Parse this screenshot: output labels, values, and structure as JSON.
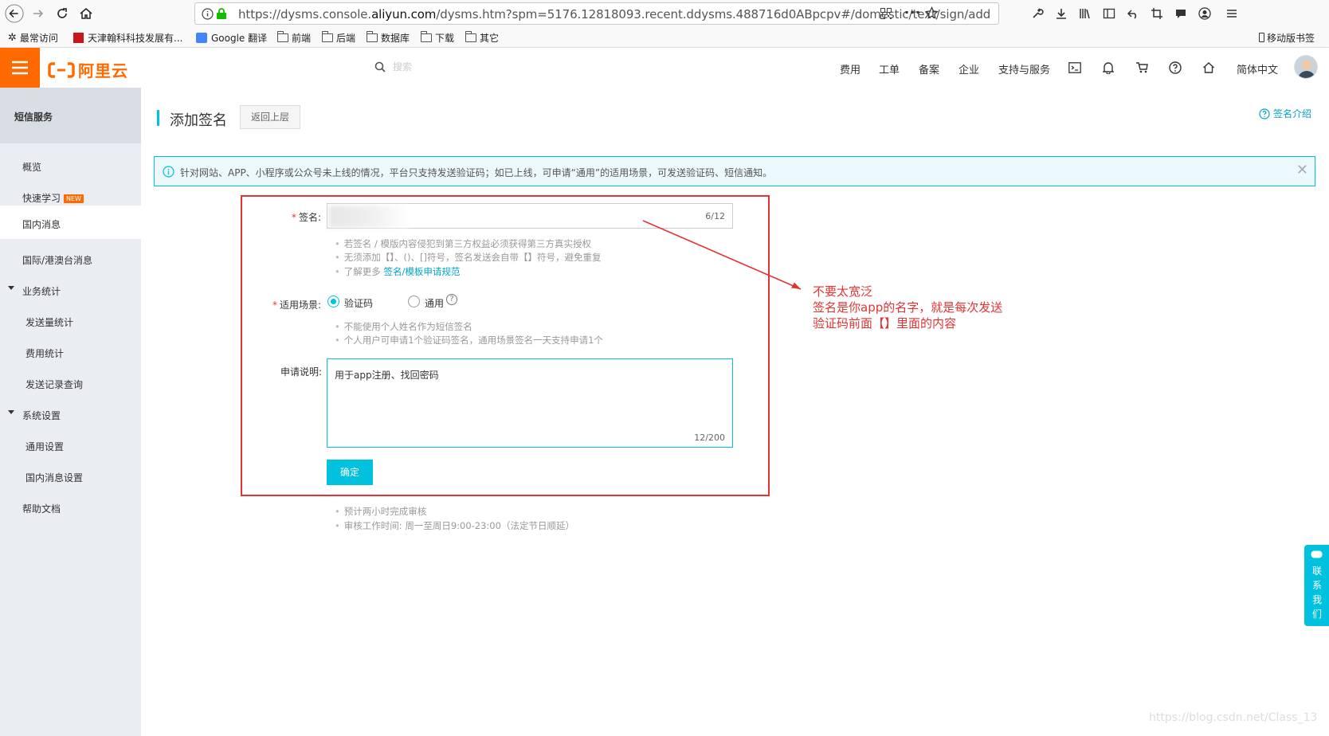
{
  "browser": {
    "url_prefix": "https://dysms.console.",
    "url_domain": "aliyun.com",
    "url_suffix": "/dysms.htm?spm=5176.12818093.recent.ddysms.488716d0ABpcpv#/domestic/text/sign/add",
    "bookmarks": [
      {
        "label": "最常访问"
      },
      {
        "label": "天津翰科科技发展有..."
      },
      {
        "label": "Google 翻译"
      },
      {
        "label": "前端"
      },
      {
        "label": "后端"
      },
      {
        "label": "数据库"
      },
      {
        "label": "下载"
      },
      {
        "label": "其它"
      }
    ],
    "mobile_bookmarks": "移动版书签"
  },
  "header": {
    "logo_text": "阿里云",
    "search_placeholder": "搜索",
    "nav": [
      "费用",
      "工单",
      "备案",
      "企业",
      "支持与服务"
    ],
    "language": "简体中文"
  },
  "sidebar": {
    "title": "短信服务",
    "items": [
      {
        "label": "概览"
      },
      {
        "label": "快速学习",
        "badge": "NEW"
      },
      {
        "label": "国内消息"
      },
      {
        "label": "国际/港澳台消息"
      },
      {
        "label": "业务统计"
      },
      {
        "label": "发送量统计"
      },
      {
        "label": "费用统计"
      },
      {
        "label": "发送记录查询"
      },
      {
        "label": "系统设置"
      },
      {
        "label": "通用设置"
      },
      {
        "label": "国内消息设置"
      },
      {
        "label": "帮助文档"
      }
    ]
  },
  "page": {
    "title": "添加签名",
    "back_label": "返回上层",
    "intro_link": "签名介绍",
    "banner": "针对网站、APP、小程序或公众号未上线的情况，平台只支持发送验证码；如已上线，可申请“通用”的适用场景，可发送验证码、短信通知。"
  },
  "form": {
    "sign_label": "签名:",
    "sign_count": "6/12",
    "sign_hints": [
      "若签名 / 模版内容侵犯到第三方权益必须获得第三方真实授权",
      "无须添加【】、()、[]符号，签名发送会自带【】符号，避免重复"
    ],
    "sign_more_prefix": "了解更多 ",
    "sign_more_link": "签名/模板申请规范",
    "scene_label": "适用场景:",
    "scene_options": [
      "验证码",
      "通用"
    ],
    "scene_hints": [
      "不能使用个人姓名作为短信签名",
      "个人用户可申请1个验证码签名，通用场景签名一天支持申请1个"
    ],
    "desc_label": "申请说明:",
    "desc_value": "用于app注册、找回密码",
    "desc_count": "12/200",
    "submit_label": "确定",
    "footer_hints": [
      "预计两小时完成审核",
      "审核工作时间: 周一至周日9:00-23:00（法定节日顺延）"
    ]
  },
  "annotation": {
    "lines": [
      "不要太宽泛",
      "签名是你app的名字，就是每次发送",
      "验证码前面【】里面的内容"
    ],
    "color": "#e53333"
  },
  "contact_tab": "联系我们",
  "watermark": "https://blog.csdn.net/Class_13",
  "colors": {
    "brand": "#ff6a00",
    "accent": "#00c1de",
    "link": "#00a2ca"
  }
}
